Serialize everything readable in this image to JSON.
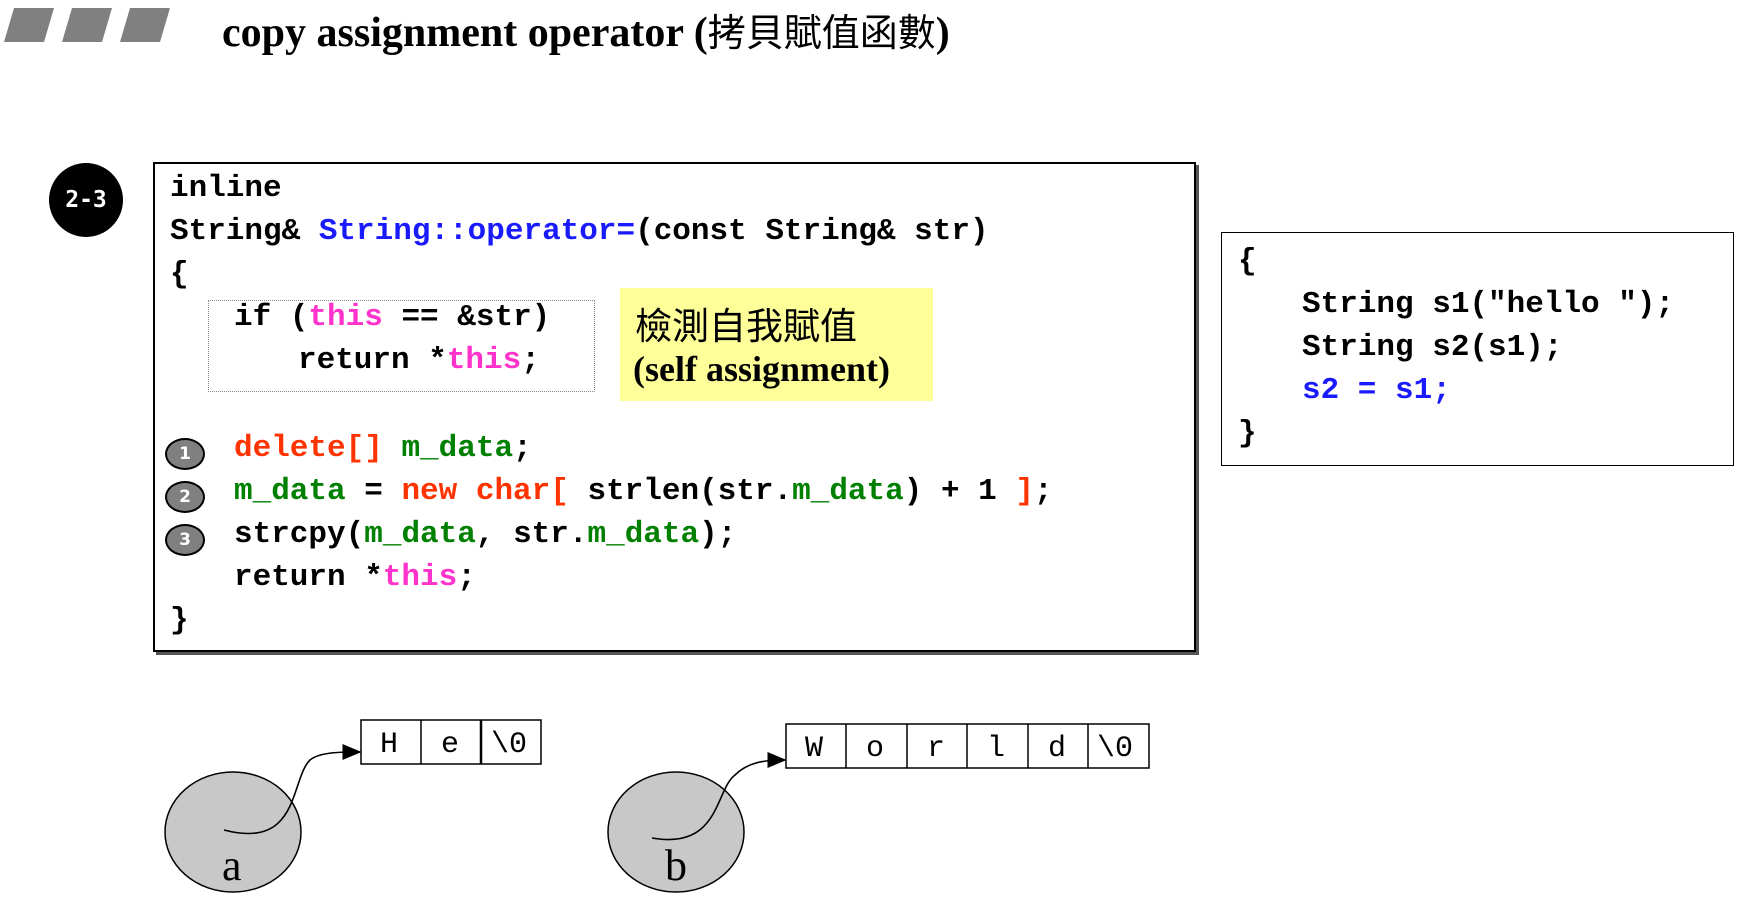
{
  "header": {
    "title_en": "copy assignment operator (",
    "title_cjk": "拷貝賦值函數",
    "title_close": ")"
  },
  "step_badge": "2-3",
  "code": {
    "line1": "inline",
    "line2_a": "String& ",
    "line2_b": "String::operator=",
    "line2_c": "(const String& str)",
    "line3": "{",
    "line4_a": "if (",
    "line4_b": "this",
    "line4_c": " == &str)",
    "line5_a": "return *",
    "line5_b": "this",
    "line5_c": ";",
    "line6_a": "delete[] ",
    "line6_b": "m_data",
    "line6_c": ";",
    "line7_a": "m_data",
    "line7_b": " = ",
    "line7_c": "new char[",
    "line7_d": " strlen(str.",
    "line7_e": "m_data",
    "line7_f": ") + 1 ",
    "line7_g": "]",
    "line7_h": ";",
    "line8_a": "strcpy(",
    "line8_b": "m_data",
    "line8_c": ", str.",
    "line8_d": "m_data",
    "line8_e": ");",
    "line9_a": "return *",
    "line9_b": "this",
    "line9_c": ";",
    "line10": "}"
  },
  "note": {
    "line1": "檢測自我賦值",
    "line2": "(self assignment)"
  },
  "step_numbers": [
    "1",
    "2",
    "3"
  ],
  "usage": {
    "line1": "{",
    "line2": "String s1(\"hello \");",
    "line3": "String s2(s1);",
    "line4": "s2 = s1;",
    "line5": "}"
  },
  "diagram": {
    "a_label": "a",
    "b_label": "b",
    "a_cells": [
      "H",
      "e",
      "\\0"
    ],
    "b_cells": [
      "W",
      "o",
      "r",
      "l",
      "d",
      "\\0"
    ]
  },
  "colors": {
    "blue": "#1a1aff",
    "pink": "#ff33cc",
    "red": "#ff3300",
    "green": "#008000",
    "note_bg": "#ffff99",
    "circle_fill": "#c8c8c8"
  }
}
